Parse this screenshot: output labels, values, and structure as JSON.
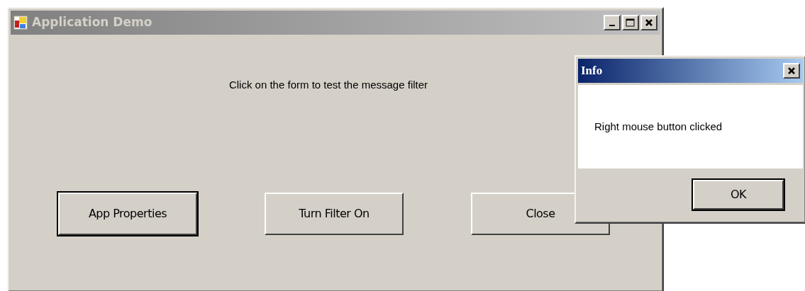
{
  "main_window": {
    "title": "Application Demo",
    "active": false,
    "message": "Click on the form to test the message filter",
    "buttons": [
      {
        "label": "App Properties",
        "default": true
      },
      {
        "label": "Turn Filter On",
        "default": false
      },
      {
        "label": "Close",
        "default": false
      }
    ]
  },
  "dialog": {
    "title": "Info",
    "active": true,
    "message": "Right mouse button clicked",
    "buttons": [
      {
        "label": "OK",
        "default": true
      }
    ]
  }
}
